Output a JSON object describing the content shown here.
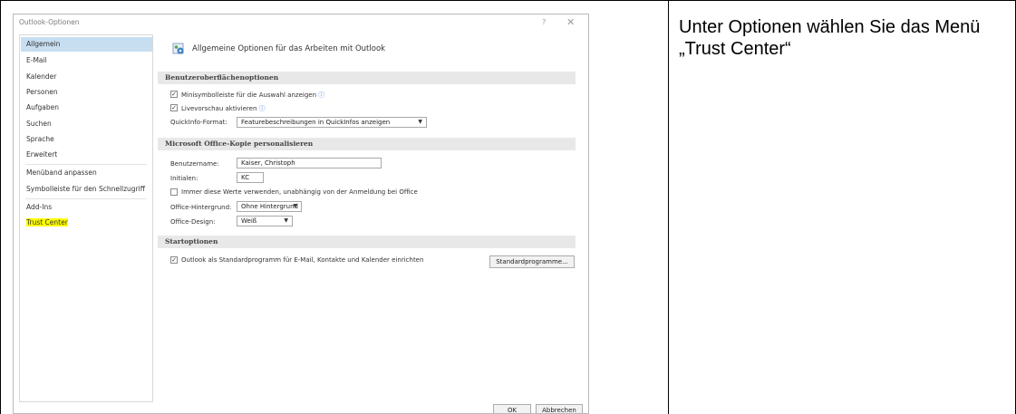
{
  "dialog": {
    "title": "Outlook-Optionen",
    "help_glyph": "?",
    "close_glyph": "✕"
  },
  "sidebar": {
    "items": [
      {
        "label": "Allgemein"
      },
      {
        "label": "E-Mail"
      },
      {
        "label": "Kalender"
      },
      {
        "label": "Personen"
      },
      {
        "label": "Aufgaben"
      },
      {
        "label": "Suchen"
      },
      {
        "label": "Sprache"
      },
      {
        "label": "Erweitert"
      },
      {
        "label": "Menüband anpassen"
      },
      {
        "label": "Symbolleiste für den Schnellzugriff"
      },
      {
        "label": "Add-Ins"
      },
      {
        "label": "Trust Center"
      }
    ]
  },
  "main": {
    "header": "Allgemeine Optionen für das Arbeiten mit Outlook",
    "ui_section": {
      "title": "Benutzeroberflächenoptionen",
      "minitoolbar_label": "Minisymbolleiste für die Auswahl anzeigen",
      "livepreview_label": "Livevorschau aktivieren",
      "quickinfo_label": "QuickInfo-Format:",
      "quickinfo_value": "Featurebeschreibungen in QuickInfos anzeigen"
    },
    "personalize_section": {
      "title": "Microsoft Office-Kopie personalisieren",
      "username_label": "Benutzername:",
      "username_value": "Kaiser, Christoph",
      "initials_label": "Initialen:",
      "initials_value": "KC",
      "always_use_label": "Immer diese Werte verwenden, unabhängig von der Anmeldung bei Office",
      "background_label": "Office-Hintergrund:",
      "background_value": "Ohne Hintergrund",
      "design_label": "Office-Design:",
      "design_value": "Weiß"
    },
    "start_section": {
      "title": "Startoptionen",
      "default_label": "Outlook als Standardprogramm für E-Mail, Kontakte und Kalender einrichten",
      "default_programs_button": "Standardprogramme..."
    }
  },
  "footer": {
    "ok_label": "OK",
    "cancel_label": "Abbrechen"
  },
  "instruction": {
    "text": "Unter Optionen wählen Sie das Menü „Trust Center“"
  },
  "colors": {
    "selected_nav": "#c7def1",
    "highlight": "#ffff00",
    "section_bg": "#e8e8e8"
  }
}
